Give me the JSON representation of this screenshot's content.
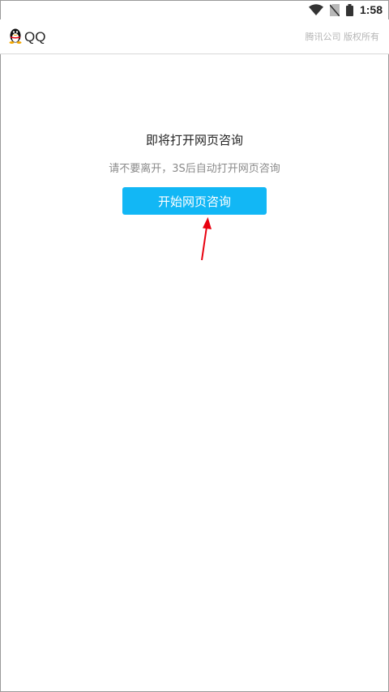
{
  "status_bar": {
    "time": "1:58",
    "icons": [
      "wifi-icon",
      "no-sim-icon",
      "battery-icon"
    ]
  },
  "header": {
    "app_name": "QQ",
    "copyright": "腾讯公司 版权所有"
  },
  "main": {
    "title": "即将打开网页咨询",
    "subtitle": "请不要离开，3S后自动打开网页咨询",
    "button_label": "开始网页咨询"
  },
  "colors": {
    "button": "#12b7f5",
    "annotation_arrow": "#e8000f"
  }
}
